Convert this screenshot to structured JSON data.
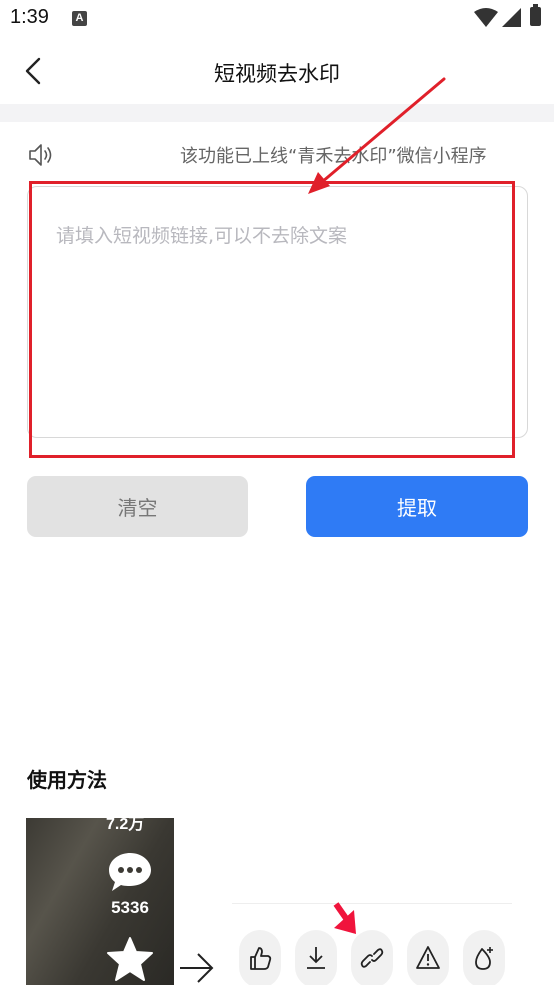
{
  "status_bar": {
    "time": "1:39",
    "app_icon_letter": "A"
  },
  "nav": {
    "title": "短视频去水印"
  },
  "notice": {
    "text": "该功能已上线“青禾去水印”微信小程序"
  },
  "input": {
    "placeholder": "请填入短视频链接,可以不去除文案",
    "value": ""
  },
  "buttons": {
    "clear_label": "清空",
    "extract_label": "提取"
  },
  "usage": {
    "title": "使用方法",
    "demo": {
      "count_top": "7.2万",
      "comment_count": "5336"
    },
    "share_icons": [
      "like-icon",
      "download-icon",
      "link-icon",
      "report-icon",
      "dislike-icon"
    ]
  },
  "colors": {
    "accent": "#2f7bf5",
    "annotation": "#e0202a",
    "clear_bg": "#e2e2e2"
  }
}
